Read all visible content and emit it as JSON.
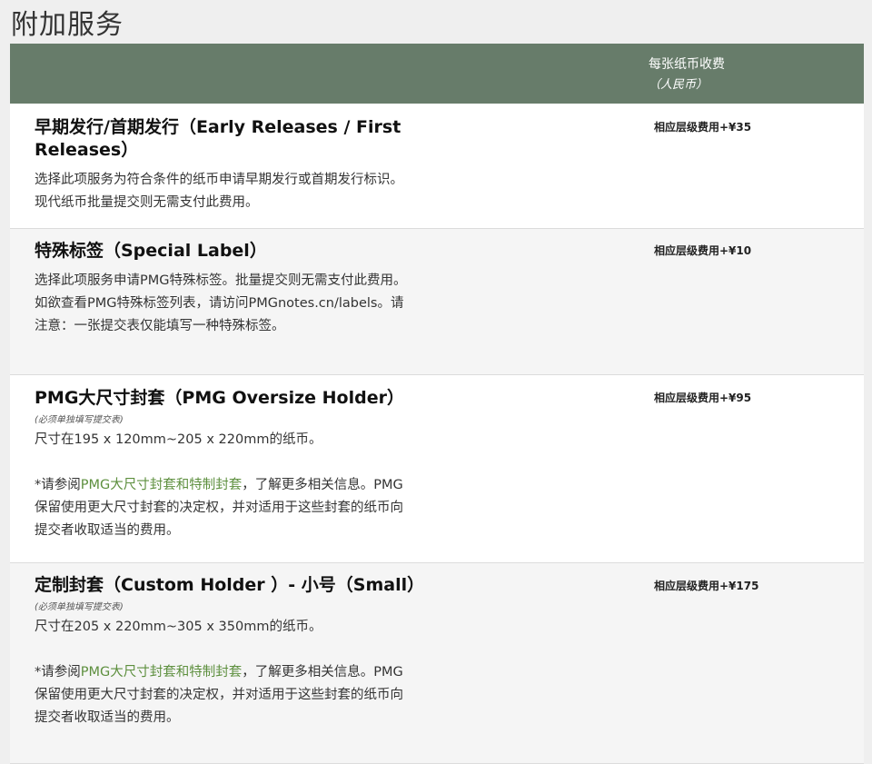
{
  "page": {
    "title": "附加服务"
  },
  "table": {
    "header": {
      "fee_label": "每张纸币收费",
      "fee_sub": "（人民币）"
    },
    "rows": [
      {
        "name": "早期发行/首期发行（Early Releases / First Releases）",
        "desc": "选择此项服务为符合条件的纸币申请早期发行或首期发行标识。现代纸币批量提交则无需支付此费用。",
        "fee": "相应层级费用+¥35"
      },
      {
        "name": "特殊标签（Special Label）",
        "desc": "选择此项服务申请PMG特殊标签。批量提交则无需支付此费用。如欲查看PMG特殊标签列表，请访问PMGnotes.cn/labels。请注意：一张提交表仅能填写一种特殊标签。",
        "fee": "相应层级费用+¥10"
      },
      {
        "name": "PMG大尺寸封套（PMG Oversize Holder）",
        "note": "(必须单独填写提交表)",
        "size": "尺寸在195 x 120mm~205 x 220mm的纸币。",
        "ref_pre": "*请参阅",
        "ref_link": "PMG大尺寸封套和特制封套",
        "ref_post": "，了解更多相关信息。PMG保留使用更大尺寸封套的决定权，并对适用于这些封套的纸币向提交者收取适当的费用。",
        "fee": "相应层级费用+¥95"
      },
      {
        "name": "定制封套（Custom Holder ）- 小号（Small）",
        "note": "(必须单独填写提交表)",
        "size": "尺寸在205 x 220mm~305 x 350mm的纸币。",
        "ref_pre": "*请参阅",
        "ref_link": "PMG大尺寸封套和特制封套",
        "ref_post": "，了解更多相关信息。PMG保留使用更大尺寸封套的决定权，并对适用于这些封套的纸币向提交者收取适当的费用。",
        "fee": "相应层级费用+¥175"
      }
    ]
  }
}
